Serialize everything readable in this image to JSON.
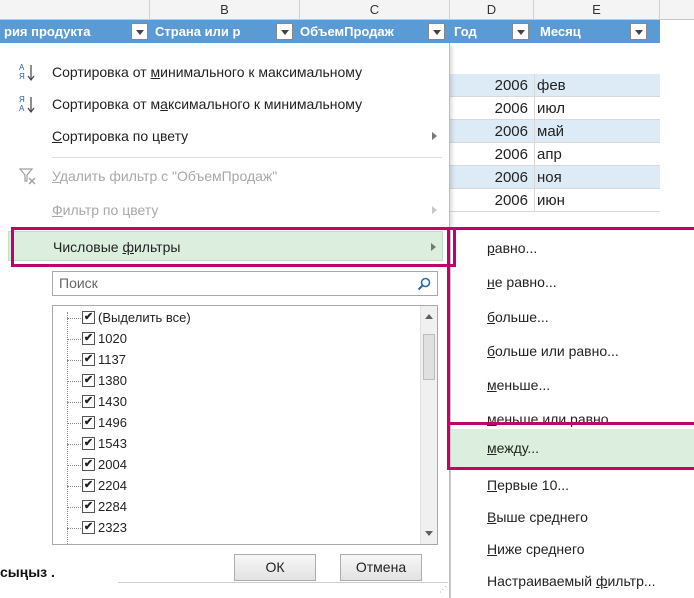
{
  "sheet": {
    "column_letters": [
      "B",
      "C",
      "D",
      "E"
    ],
    "headers": [
      {
        "label": "рия продукта"
      },
      {
        "label": "Страна или р"
      },
      {
        "label": "ОбъемПродаж"
      },
      {
        "label": "Год"
      },
      {
        "label": "Месяц"
      }
    ],
    "rows": [
      {
        "year": "2006",
        "month": "фев"
      },
      {
        "year": "2006",
        "month": "июл"
      },
      {
        "year": "2006",
        "month": "май"
      },
      {
        "year": "2006",
        "month": "апр"
      },
      {
        "year": "2006",
        "month": "ноя"
      },
      {
        "year": "2006",
        "month": "июн"
      }
    ]
  },
  "menu": {
    "sort_asc": {
      "pre": "Сортировка от ",
      "key": "м",
      "post": "инимального к максимальному"
    },
    "sort_desc": {
      "pre": "Сортировка от м",
      "key": "а",
      "post": "ксимального к минимальному"
    },
    "sort_color": {
      "key": "С",
      "post": "ортировка по цвету"
    },
    "clear_filter": {
      "key": "У",
      "post": "далить фильтр с \"ОбъемПродаж\""
    },
    "filter_color": {
      "key": "Ф",
      "post": "ильтр по цвету"
    },
    "number_filters": {
      "pre": "Числовые ",
      "key": "ф",
      "post": "ильтры"
    },
    "search_placeholder": "Поиск",
    "list_items": [
      {
        "label": "(Выделить все)",
        "checked": "✔"
      },
      {
        "label": "1020",
        "checked": "✔"
      },
      {
        "label": "1137",
        "checked": "✔"
      },
      {
        "label": "1380",
        "checked": "✔"
      },
      {
        "label": "1430",
        "checked": "✔"
      },
      {
        "label": "1496",
        "checked": "✔"
      },
      {
        "label": "1543",
        "checked": "✔"
      },
      {
        "label": "2004",
        "checked": "✔"
      },
      {
        "label": "2204",
        "checked": "✔"
      },
      {
        "label": "2284",
        "checked": "✔"
      },
      {
        "label": "2323",
        "checked": "✔"
      }
    ],
    "ok_label": "ОК",
    "cancel_label": "Отмена"
  },
  "submenu": [
    {
      "key": "р",
      "post": "авно..."
    },
    {
      "key": "н",
      "post": "е равно..."
    },
    {
      "key": "б",
      "post": "ольше..."
    },
    {
      "pre": "",
      "key": "б",
      "post": "ольше или равно..."
    },
    {
      "key": "м",
      "post": "еньше..."
    },
    {
      "key": "м",
      "post": "еньше или равно..."
    },
    {
      "key": "м",
      "post": "ежду..."
    },
    {
      "key": "П",
      "post": "ервые 10..."
    },
    {
      "key": "В",
      "post": "ыше среднего"
    },
    {
      "key": "Н",
      "post": "иже среднего"
    },
    {
      "pre": "Настраиваемый ",
      "key": "ф",
      "post": "ильтр..."
    }
  ],
  "caption": "сыңыз .",
  "colors": {
    "header_blue": "#5b9bd5",
    "band_blue": "#ddebf7",
    "highlight_green": "#dcefde",
    "callout_magenta": "#c2006e"
  }
}
